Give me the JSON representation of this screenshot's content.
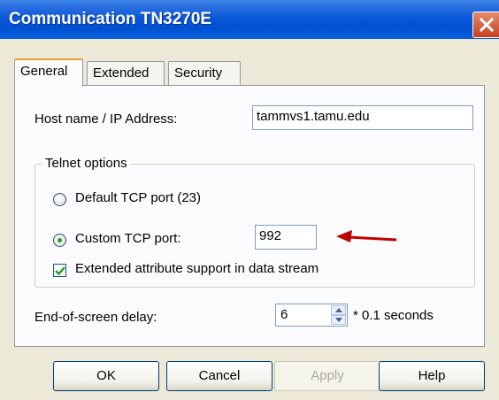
{
  "window": {
    "title": "Communication TN3270E"
  },
  "tabs": [
    {
      "label": "General",
      "active": true
    },
    {
      "label": "Extended",
      "active": false
    },
    {
      "label": "Security",
      "active": false
    }
  ],
  "general": {
    "host_label": "Host name / IP Address:",
    "host_value": "tammvs1.tamu.edu",
    "telnet_group_label": "Telnet options",
    "default_port_label": "Default TCP port (23)",
    "default_port_selected": false,
    "custom_port_label": "Custom TCP port:",
    "custom_port_selected": true,
    "custom_port_value": "992",
    "extended_attr_label": "Extended attribute support in data stream",
    "extended_attr_checked": true,
    "eos_delay_label": "End-of-screen delay:",
    "eos_delay_value": "6",
    "eos_delay_unit": "* 0.1 seconds"
  },
  "annotation": {
    "arrow_color": "#c00000"
  },
  "buttons": {
    "ok": "OK",
    "cancel": "Cancel",
    "apply": "Apply",
    "apply_enabled": false,
    "help": "Help"
  }
}
